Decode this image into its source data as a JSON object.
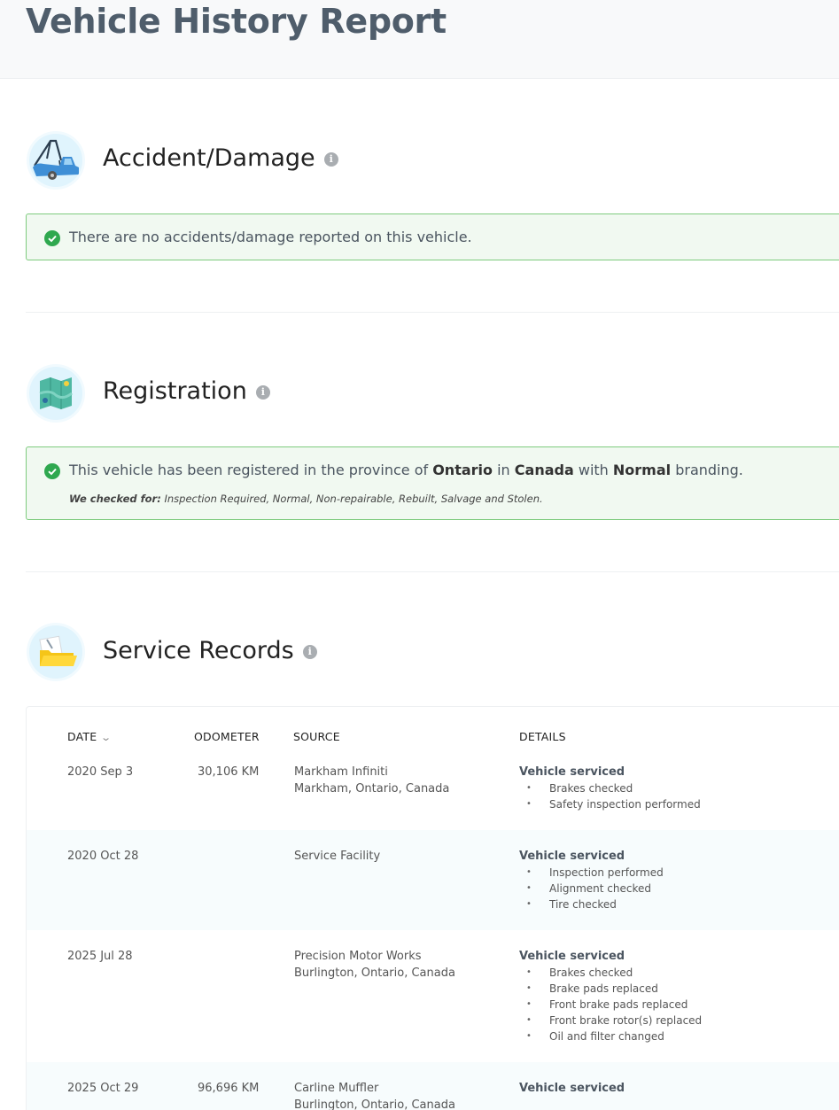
{
  "page": {
    "title": "Vehicle History Report"
  },
  "colors": {
    "success_bg": "#f1f9f1",
    "success_border": "#7ecb7e",
    "check_green": "#2fa84f",
    "title_gray": "#4f5d6b"
  },
  "accident": {
    "title": "Accident/Damage",
    "icon": "tow-truck-icon",
    "message": "There are no accidents/damage reported on this vehicle."
  },
  "registration": {
    "title": "Registration",
    "icon": "map-icon",
    "msg_prefix": "This vehicle has been registered in the province of ",
    "province": "Ontario",
    "msg_in": " in ",
    "country": "Canada",
    "msg_with": " with ",
    "branding": "Normal",
    "msg_suffix": " branding.",
    "checked_label": "We checked for:",
    "checked_list": " Inspection Required, Normal, Non-repairable, Rebuilt, Salvage and Stolen."
  },
  "service": {
    "title": "Service Records",
    "icon": "folder-icon",
    "columns": {
      "date": "DATE",
      "odometer": "ODOMETER",
      "source": "SOURCE",
      "details": "DETAILS"
    },
    "rows": [
      {
        "date": "2020 Sep 3",
        "odometer": "30,106 KM",
        "source_name": "Markham Infiniti",
        "source_location": "Markham, Ontario, Canada",
        "details_head": "Vehicle serviced",
        "items": [
          "Brakes checked",
          "Safety inspection performed"
        ]
      },
      {
        "date": "2020 Oct 28",
        "odometer": "",
        "source_name": "Service Facility",
        "source_location": "",
        "details_head": "Vehicle serviced",
        "items": [
          "Inspection performed",
          "Alignment checked",
          "Tire checked"
        ]
      },
      {
        "date": "2025 Jul 28",
        "odometer": "",
        "source_name": "Precision Motor Works",
        "source_location": "Burlington, Ontario, Canada",
        "details_head": "Vehicle serviced",
        "items": [
          "Brakes checked",
          "Brake pads replaced",
          "Front brake pads replaced",
          "Front brake rotor(s) replaced",
          "Oil and filter changed"
        ]
      },
      {
        "date": "2025 Oct 29",
        "odometer": "96,696 KM",
        "source_name": "Carline Muffler",
        "source_location": "Burlington, Ontario, Canada",
        "details_head": "Vehicle serviced",
        "items": []
      }
    ]
  }
}
